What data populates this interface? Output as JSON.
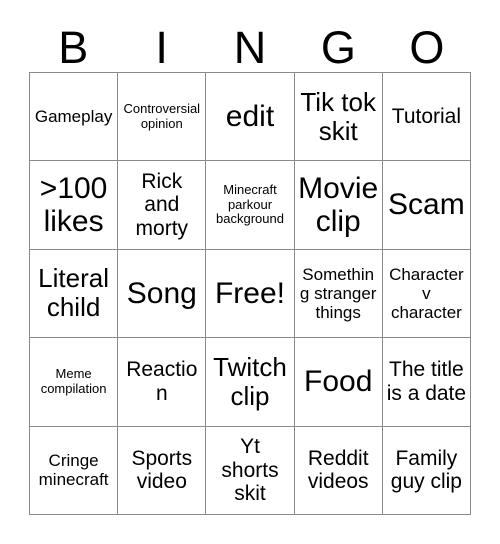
{
  "card": {
    "title_letters": [
      "B",
      "I",
      "N",
      "G",
      "O"
    ],
    "grid_line_color": "#8a8a8a",
    "text_color": "#000000",
    "background_color": "#ffffff",
    "rows": 5,
    "columns": 5,
    "cells": [
      {
        "text": "Gameplay",
        "size": "sm"
      },
      {
        "text": "Controversial opinion",
        "size": "xs"
      },
      {
        "text": "edit",
        "size": "xl"
      },
      {
        "text": "Tik tok skit",
        "size": "lg"
      },
      {
        "text": "Tutorial",
        "size": "md"
      },
      {
        "text": ">100 likes",
        "size": "xl"
      },
      {
        "text": "Rick and morty",
        "size": "md"
      },
      {
        "text": "Minecraft parkour background",
        "size": "xs"
      },
      {
        "text": "Movie clip",
        "size": "xl"
      },
      {
        "text": "Scam",
        "size": "xl"
      },
      {
        "text": "Literal child",
        "size": "lg"
      },
      {
        "text": "Song",
        "size": "xl"
      },
      {
        "text": "Free!",
        "size": "xl"
      },
      {
        "text": "Something stranger things",
        "size": "sm"
      },
      {
        "text": "Character v character",
        "size": "sm"
      },
      {
        "text": "Meme compilation",
        "size": "xs"
      },
      {
        "text": "Reaction",
        "size": "md"
      },
      {
        "text": "Twitch clip",
        "size": "lg"
      },
      {
        "text": "Food",
        "size": "xl"
      },
      {
        "text": "The title is a date",
        "size": "md"
      },
      {
        "text": "Cringe minecraft",
        "size": "sm"
      },
      {
        "text": "Sports video",
        "size": "md"
      },
      {
        "text": "Yt shorts skit",
        "size": "md"
      },
      {
        "text": "Reddit videos",
        "size": "md"
      },
      {
        "text": "Family guy clip",
        "size": "md"
      }
    ]
  }
}
